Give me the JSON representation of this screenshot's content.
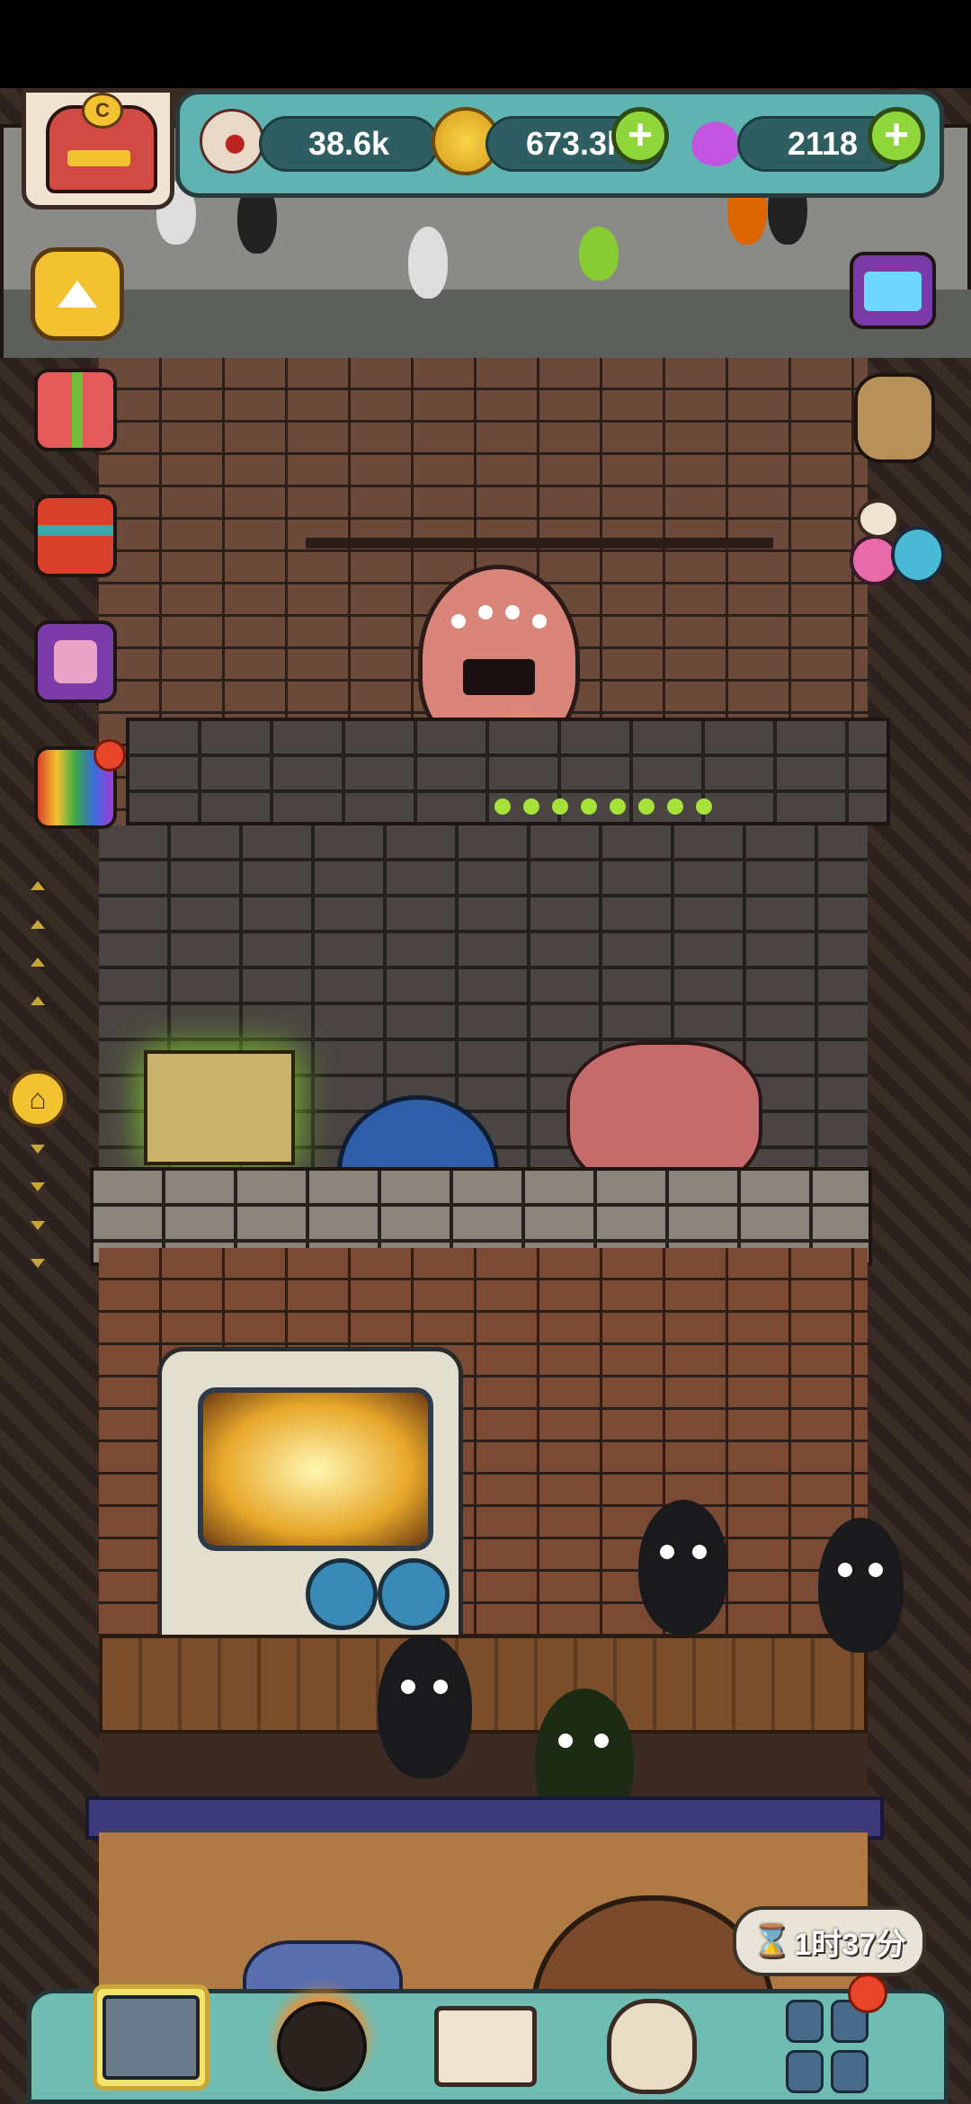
{
  "resources": {
    "eyes": {
      "icon": "eyeball-icon",
      "value": "38.6k"
    },
    "coins": {
      "icon": "gold-coin-icon",
      "value": "673.3k",
      "add_icon": "plus-icon"
    },
    "potions": {
      "icon": "potion-flask-icon",
      "value": "2118",
      "add_icon": "plus-icon"
    }
  },
  "player": {
    "avatar_icon": "dungeon-rank-badge-icon",
    "rank_letter": "C"
  },
  "side_left": [
    {
      "name": "scroll-up-icon"
    },
    {
      "name": "gift-box-green-icon"
    },
    {
      "name": "gift-box-red-icon"
    },
    {
      "name": "card-pack-icon"
    },
    {
      "name": "gift-box-rainbow-icon",
      "badge": true
    }
  ],
  "side_right": [
    {
      "name": "tv-ad-icon"
    },
    {
      "name": "backpack-icon"
    },
    {
      "name": "mushroom-creatures-icon"
    }
  ],
  "floor_nav": {
    "home_icon": "home-icon"
  },
  "timer": {
    "icon": "hourglass-icon",
    "label": "1时37分"
  },
  "bottom_nav": [
    {
      "name": "dungeon-build-icon",
      "selected": true
    },
    {
      "name": "monster-summon-icon"
    },
    {
      "name": "spellbook-icon"
    },
    {
      "name": "coin-bag-icon"
    },
    {
      "name": "grid-menu-icon",
      "badge": true
    }
  ],
  "colors": {
    "panel": "#5fb3b0",
    "plus": "#8fd63a",
    "badge": "#e8452a",
    "accent": "#f2c230"
  }
}
